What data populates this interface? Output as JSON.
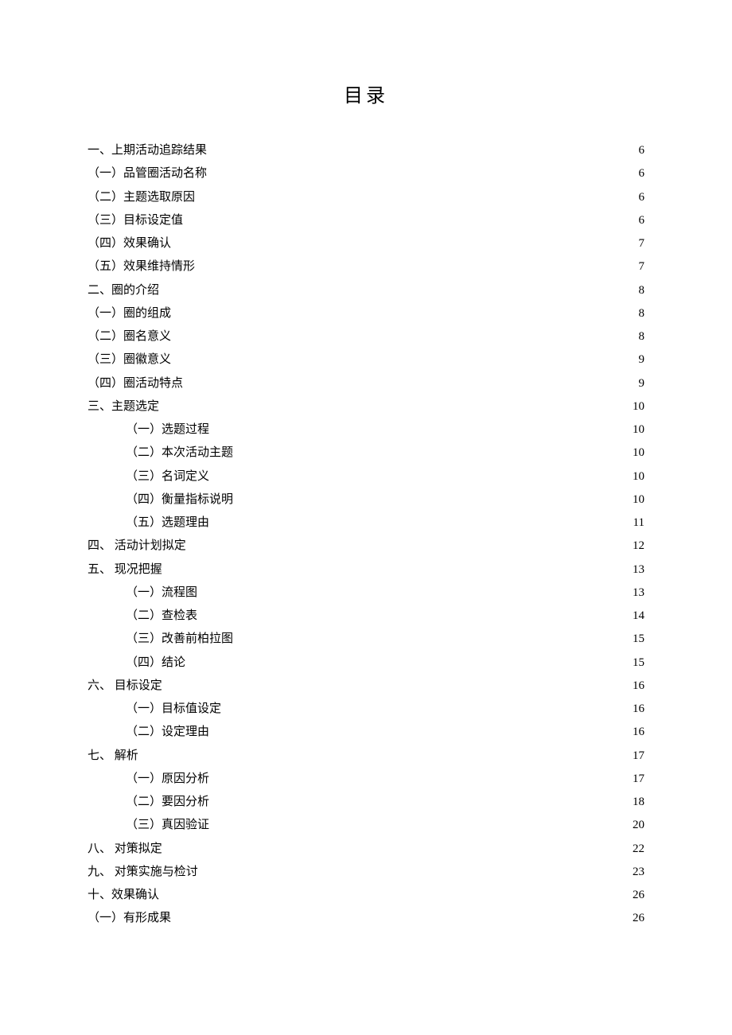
{
  "title": "目录",
  "entries": [
    {
      "label": "一、上期活动追踪结果",
      "page": "6",
      "indent": 0
    },
    {
      "label": "（一）品管圈活动名称",
      "page": "6",
      "indent": 0
    },
    {
      "label": "（二）主题选取原因",
      "page": "6",
      "indent": 0
    },
    {
      "label": "（三）目标设定值",
      "page": "6",
      "indent": 0
    },
    {
      "label": "（四）效果确认",
      "page": "7",
      "indent": 0
    },
    {
      "label": "（五）效果维持情形",
      "page": "7",
      "indent": 0
    },
    {
      "label": "二、圈的介绍",
      "page": "8",
      "indent": 0
    },
    {
      "label": "（一）圈的组成",
      "page": "8",
      "indent": 0
    },
    {
      "label": "（二）圈名意义",
      "page": "8",
      "indent": 0
    },
    {
      "label": "（三）圈徽意义",
      "page": "9",
      "indent": 0
    },
    {
      "label": "（四）圈活动特点",
      "page": "9",
      "indent": 0
    },
    {
      "label": "三、主题选定",
      "page": "10",
      "indent": 0
    },
    {
      "label": "（一）选题过程",
      "page": "10",
      "indent": 1
    },
    {
      "label": "（二）本次活动主题",
      "page": "10",
      "indent": 1
    },
    {
      "label": "（三）名词定义",
      "page": "10",
      "indent": 1
    },
    {
      "label": "（四）衡量指标说明",
      "page": "10",
      "indent": 1
    },
    {
      "label": "（五）选题理由",
      "page": "11",
      "indent": 1
    },
    {
      "label": "四、 活动计划拟定",
      "page": "12",
      "indent": 0
    },
    {
      "label": "五、 现况把握",
      "page": "13",
      "indent": 0
    },
    {
      "label": "（一）流程图",
      "page": "13",
      "indent": 1
    },
    {
      "label": "（二）查检表",
      "page": "14",
      "indent": 1
    },
    {
      "label": "（三）改善前柏拉图",
      "page": "15",
      "indent": 1
    },
    {
      "label": "（四）结论",
      "page": "15",
      "indent": 1
    },
    {
      "label": "六、 目标设定",
      "page": "16",
      "indent": 0
    },
    {
      "label": "（一）目标值设定",
      "page": "16",
      "indent": 1
    },
    {
      "label": "（二）设定理由",
      "page": "16",
      "indent": 1
    },
    {
      "label": "七、 解析",
      "page": "17",
      "indent": 0
    },
    {
      "label": "（一）原因分析",
      "page": "17",
      "indent": 1
    },
    {
      "label": "（二）要因分析",
      "page": "18",
      "indent": 1
    },
    {
      "label": "（三）真因验证",
      "page": "20",
      "indent": 1
    },
    {
      "label": "八、 对策拟定",
      "page": "22",
      "indent": 0
    },
    {
      "label": "九、 对策实施与检讨",
      "page": "23",
      "indent": 0
    },
    {
      "label": "十、效果确认",
      "page": "26",
      "indent": 0
    },
    {
      "label": "（一）有形成果",
      "page": "26",
      "indent": 0
    }
  ]
}
